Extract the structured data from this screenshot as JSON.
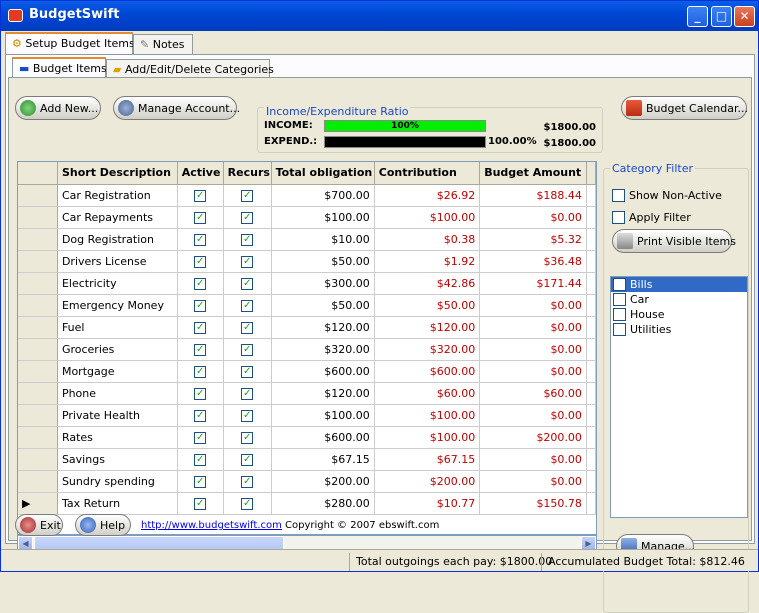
{
  "window": {
    "title": "BudgetSwift"
  },
  "tabs": [
    "Setup Budget Items",
    "Notes"
  ],
  "subtabs": [
    "Budget Items",
    "Add/Edit/Delete Categories"
  ],
  "toolbar": {
    "add_new": "Add New...",
    "manage_account": "Manage Account...",
    "budget_calendar": "Budget Calendar..."
  },
  "ratio": {
    "title": "Income/Expenditure Ratio",
    "income_label": "INCOME:",
    "income_pct": "100%",
    "income_amount": "$1800.00",
    "expend_label": "EXPEND.:",
    "expend_pct": "100.00%",
    "expend_amount": "$1800.00",
    "income_fill": 1.0,
    "expend_fill": 1.0
  },
  "grid": {
    "columns": [
      "Short Description",
      "Active",
      "Recurs",
      "Total obligation",
      "Contribution",
      "Budget Amount"
    ],
    "rows": [
      {
        "desc": "Car Registration",
        "total": "$700.00",
        "contrib": "$26.92",
        "budget": "$188.44"
      },
      {
        "desc": "Car Repayments",
        "total": "$100.00",
        "contrib": "$100.00",
        "budget": "$0.00"
      },
      {
        "desc": "Dog Registration",
        "total": "$10.00",
        "contrib": "$0.38",
        "budget": "$5.32"
      },
      {
        "desc": "Drivers License",
        "total": "$50.00",
        "contrib": "$1.92",
        "budget": "$36.48"
      },
      {
        "desc": "Electricity",
        "total": "$300.00",
        "contrib": "$42.86",
        "budget": "$171.44"
      },
      {
        "desc": "Emergency Money",
        "total": "$50.00",
        "contrib": "$50.00",
        "budget": "$0.00"
      },
      {
        "desc": "Fuel",
        "total": "$120.00",
        "contrib": "$120.00",
        "budget": "$0.00"
      },
      {
        "desc": "Groceries",
        "total": "$320.00",
        "contrib": "$320.00",
        "budget": "$0.00"
      },
      {
        "desc": "Mortgage",
        "total": "$600.00",
        "contrib": "$600.00",
        "budget": "$0.00"
      },
      {
        "desc": "Phone",
        "total": "$120.00",
        "contrib": "$60.00",
        "budget": "$60.00"
      },
      {
        "desc": "Private Health",
        "total": "$100.00",
        "contrib": "$100.00",
        "budget": "$0.00"
      },
      {
        "desc": "Rates",
        "total": "$600.00",
        "contrib": "$100.00",
        "budget": "$200.00"
      },
      {
        "desc": "Savings",
        "total": "$67.15",
        "contrib": "$67.15",
        "budget": "$0.00"
      },
      {
        "desc": "Sundry spending",
        "total": "$200.00",
        "contrib": "$200.00",
        "budget": "$0.00"
      },
      {
        "desc": "Tax Return",
        "total": "$280.00",
        "contrib": "$10.77",
        "budget": "$150.78"
      }
    ]
  },
  "filter": {
    "title": "Category Filter",
    "show_non_active": "Show Non-Active",
    "apply_filter": "Apply Filter",
    "print_button": "Print Visible Items",
    "categories": [
      "Bills",
      "Car",
      "House",
      "Utilities"
    ],
    "manage": "Manage..."
  },
  "footer": {
    "exit": "Exit",
    "help": "Help",
    "link": "http://www.budgetswift.com",
    "copyright": "Copyright © 2007 ebswift.com"
  },
  "status": {
    "outgoings": "Total outgoings each pay: $1800.00",
    "accumulated": "Accumulated Budget Total: $812.46"
  },
  "colors": {
    "income_bar": "#00ee00",
    "expend_bar": "#000000",
    "amount_red": "#c00000",
    "accent": "#1a48c8"
  }
}
